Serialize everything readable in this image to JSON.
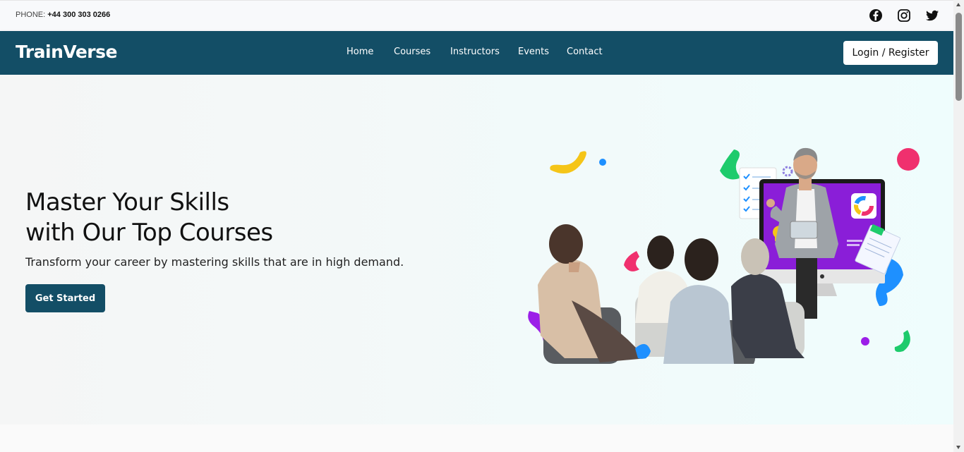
{
  "topbar": {
    "phone_label": "PHONE:",
    "phone_number": "+44 300 303 0266",
    "social_icons": [
      "facebook-icon",
      "instagram-icon",
      "twitter-icon"
    ]
  },
  "navbar": {
    "brand": "TrainVerse",
    "links": [
      "Home",
      "Courses",
      "Instructors",
      "Events",
      "Contact"
    ],
    "login_label": "Login / Register"
  },
  "hero": {
    "title_line1": "Master Your Skills",
    "title_line2": "with Our Top Courses",
    "subtitle": "Transform your career by mastering skills that are in high demand.",
    "cta_label": "Get Started"
  },
  "colors": {
    "brand_primary": "#134e66",
    "accent_yellow": "#f5c518",
    "accent_pink": "#f0306e",
    "accent_green": "#1ecb6c",
    "accent_purple": "#9b1ee8",
    "accent_blue": "#1e90ff"
  }
}
